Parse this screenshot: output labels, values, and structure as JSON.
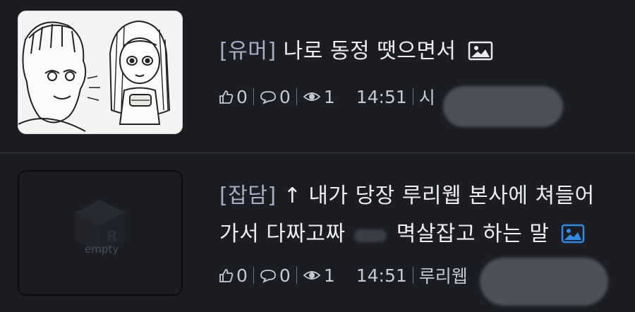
{
  "posts": [
    {
      "category": "[유머]",
      "title": "나로 동정 땟으면서",
      "has_image_icon": true,
      "image_icon_color": "#e8eaee",
      "likes": "0",
      "comments": "0",
      "views": "1",
      "time": "14:51",
      "author_partial": "시"
    },
    {
      "category": "[잡담]",
      "title_line1": "↑ 내가 당장 루리웹 본사에 쳐들어",
      "title_line2_a": "가서 다짜고짜",
      "title_line2_b": "멱살잡고 하는 말",
      "has_image_icon": true,
      "image_icon_color": "#2f8be8",
      "thumbnail_label": "empty",
      "likes": "0",
      "comments": "0",
      "views": "1",
      "time": "14:51",
      "author_partial": "루리웹"
    }
  ],
  "icons": {
    "like": "thumbs-up-icon",
    "comment": "speech-bubble-icon",
    "view": "eye-icon",
    "image": "image-icon"
  },
  "colors": {
    "background": "#1b1d22",
    "category": "#a9aec4",
    "title": "#eceef2",
    "meta": "#c7cad2"
  }
}
